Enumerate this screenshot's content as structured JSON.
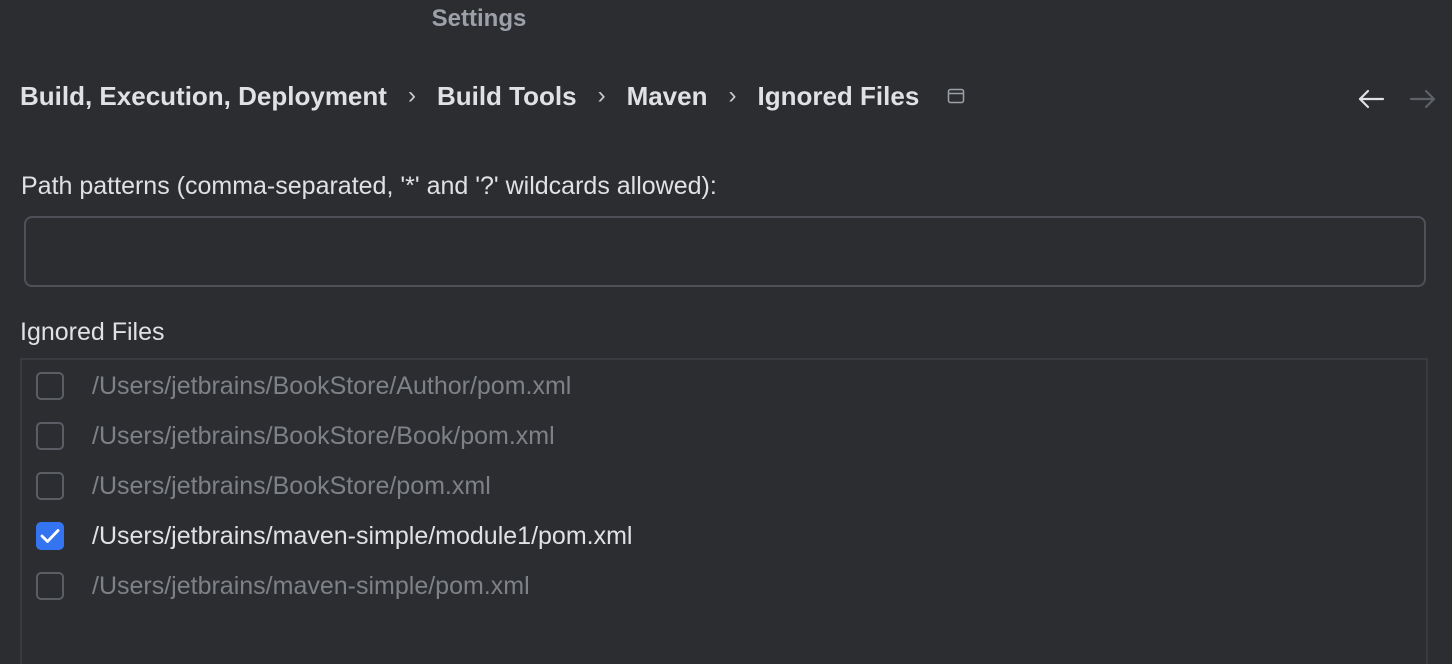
{
  "window": {
    "title": "Settings"
  },
  "breadcrumb": {
    "items": [
      "Build, Execution, Deployment",
      "Build Tools",
      "Maven",
      "Ignored Files"
    ],
    "separator": "›"
  },
  "nav": {
    "back_icon": "arrow-left-icon",
    "forward_icon": "arrow-right-icon",
    "forward_enabled": false
  },
  "path_patterns": {
    "label": "Path patterns (comma-separated, '*' and '?' wildcards allowed):",
    "value": "",
    "placeholder": ""
  },
  "ignored_files": {
    "label": "Ignored Files",
    "items": [
      {
        "path": "/Users/jetbrains/BookStore/Author/pom.xml",
        "checked": false
      },
      {
        "path": "/Users/jetbrains/BookStore/Book/pom.xml",
        "checked": false
      },
      {
        "path": "/Users/jetbrains/BookStore/pom.xml",
        "checked": false
      },
      {
        "path": "/Users/jetbrains/maven-simple/module1/pom.xml",
        "checked": true
      },
      {
        "path": "/Users/jetbrains/maven-simple/pom.xml",
        "checked": false
      }
    ]
  },
  "colors": {
    "background": "#2b2d30",
    "accent": "#3574f0",
    "text": "#dfe1e5",
    "muted_text": "#7e8187"
  }
}
